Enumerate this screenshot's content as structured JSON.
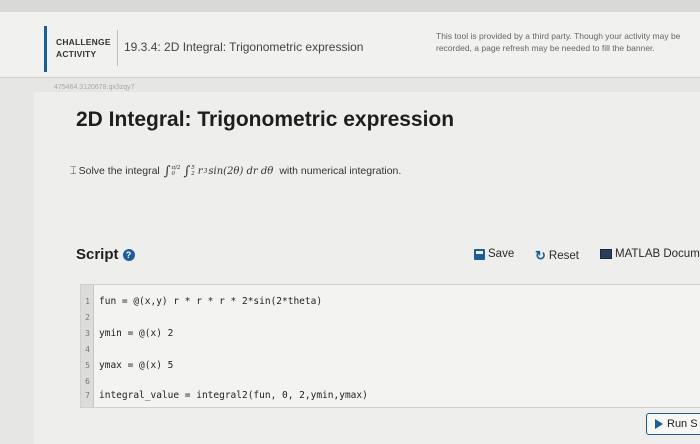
{
  "banner": {
    "badge_line1": "CHALLENGE",
    "badge_line2": "ACTIVITY",
    "lesson_title": "19.3.4: 2D Integral: Trigonometric expression",
    "third_party_notice": "This tool is provided by a third party. Though your activity may be recorded, a page refresh may be needed to fill the banner."
  },
  "faint_id": "475464.3120678.qx3zqy7",
  "heading": "2D Integral: Trigonometric expression",
  "problem": {
    "prefix": "Solve the integral",
    "suffix": "with numerical integration."
  },
  "script": {
    "label": "Script",
    "help_icon": "?",
    "save_label": "Save",
    "reset_label": "Reset",
    "matlab_label": "MATLAB Docum"
  },
  "code": {
    "lines": [
      {
        "num": "1",
        "text": "fun = @(x,y) r * r * r * 2*sin(2*theta)"
      },
      {
        "num": "2",
        "text": ""
      },
      {
        "num": "3",
        "text": "ymin = @(x) 2"
      },
      {
        "num": "4",
        "text": ""
      },
      {
        "num": "5",
        "text": "ymax = @(x) 5"
      },
      {
        "num": "6",
        "text": ""
      },
      {
        "num": "7",
        "text": "integral_value = integral2(fun, 0, 2,ymin,ymax)"
      }
    ]
  },
  "run_label": "Run S",
  "icons": {
    "save": "save-icon",
    "reset": "reset-icon",
    "matlab": "book-icon",
    "help": "help-icon",
    "run": "play-icon"
  },
  "colors": {
    "accent": "#1b5e96"
  }
}
